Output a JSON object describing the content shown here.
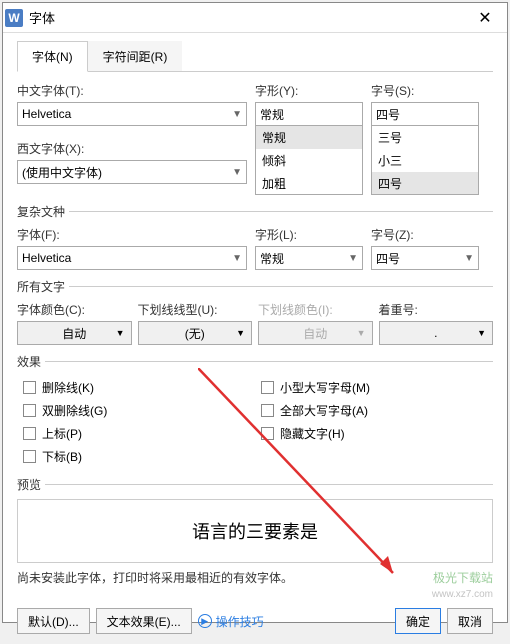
{
  "title": "字体",
  "tabs": {
    "font": "字体(N)",
    "spacing": "字符间距(R)"
  },
  "cn_font_label": "中文字体(T):",
  "cn_font_value": "Helvetica",
  "style_label": "字形(Y):",
  "style_value": "常规",
  "style_options": {
    "regular": "常规",
    "italic": "倾斜",
    "bold": "加粗"
  },
  "size_label": "字号(S):",
  "size_value": "四号",
  "size_options": {
    "s1": "三号",
    "s2": "小三",
    "s3": "四号"
  },
  "en_font_label": "西文字体(X):",
  "en_font_value": "(使用中文字体)",
  "complex_title": "复杂文种",
  "cx_font_label": "字体(F):",
  "cx_font_value": "Helvetica",
  "cx_style_label": "字形(L):",
  "cx_style_value": "常规",
  "cx_size_label": "字号(Z):",
  "cx_size_value": "四号",
  "all_text_title": "所有文字",
  "font_color_label": "字体颜色(C):",
  "font_color_value": "自动",
  "underline_label": "下划线线型(U):",
  "underline_value": "(无)",
  "underline_color_label": "下划线颜色(I):",
  "underline_color_value": "自动",
  "emphasis_label": "着重号:",
  "emphasis_value": ".",
  "effects_title": "效果",
  "fx": {
    "strike": "删除线(K)",
    "dstrike": "双删除线(G)",
    "super": "上标(P)",
    "sub": "下标(B)",
    "smallcaps": "小型大写字母(M)",
    "allcaps": "全部大写字母(A)",
    "hidden": "隐藏文字(H)"
  },
  "preview_title": "预览",
  "preview_text": "语言的三要素是",
  "note": "尚未安装此字体，打印时将采用最相近的有效字体。",
  "btn_default": "默认(D)...",
  "btn_texteffect": "文本效果(E)...",
  "link_tips": "操作技巧",
  "btn_ok": "确定",
  "btn_cancel": "取消",
  "watermark": "极光下载站",
  "watermark_url": "www.xz7.com"
}
